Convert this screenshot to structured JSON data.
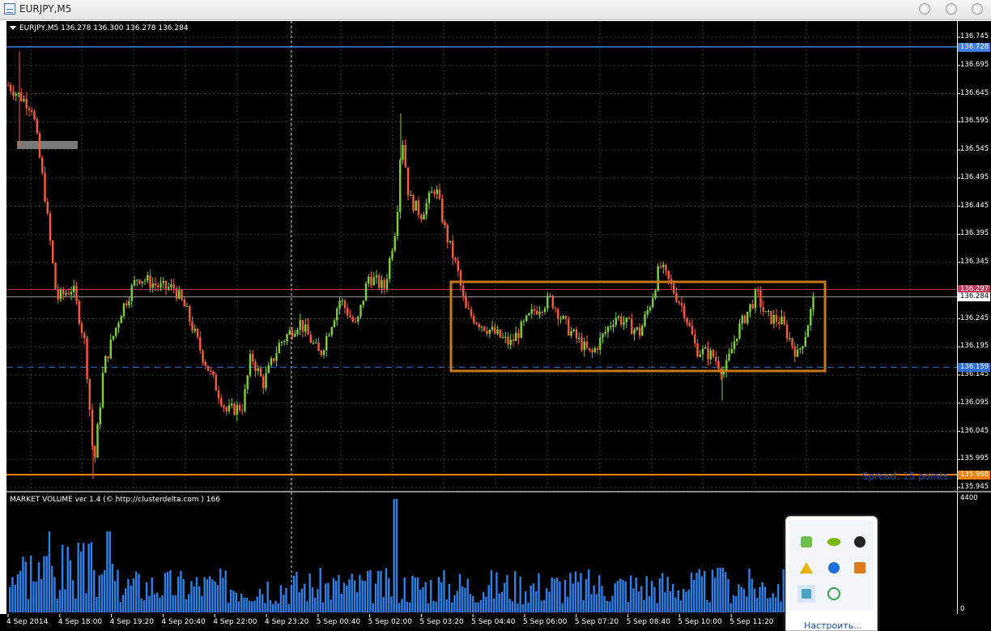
{
  "window": {
    "title": "EURJPY,M5"
  },
  "chart": {
    "info": "EURJPY,M5  136.278 136.300 136.278 136.284",
    "spread": "Spread: 15 points.",
    "price_ticks": [
      "136.745",
      "136.695",
      "136.645",
      "136.595",
      "136.545",
      "136.495",
      "136.445",
      "136.395",
      "136.345",
      "136.245",
      "136.195",
      "136.145",
      "136.095",
      "136.045",
      "135.995",
      "135.945"
    ],
    "level_tags": [
      {
        "price": "136.728",
        "color": "#3f7fe6"
      },
      {
        "price": "136.297",
        "color": "#c33b5c"
      },
      {
        "price": "136.284",
        "color": "#ffffff"
      },
      {
        "price": "136.159",
        "color": "#2f6fd9"
      },
      {
        "price": "135.968",
        "color": "#ff8000"
      }
    ],
    "colors": {
      "bull": "#7fd13a",
      "bear": "#ff5a3c",
      "range_box": "#c8791c",
      "volume": "#2f7fe8"
    }
  },
  "volume": {
    "label": "MARKET VOLUME ver 1.4 (© http://clusterdelta.com ) 166",
    "max": "4400",
    "min": "0"
  },
  "time_axis": {
    "labels": [
      "4 Sep 2014",
      "4 Sep 18:00",
      "4 Sep 19:20",
      "4 Sep 20:40",
      "4 Sep 22:00",
      "4 Sep 23:20",
      "5 Sep 00:40",
      "5 Sep 02:00",
      "5 Sep 03:20",
      "5 Sep 04:40",
      "5 Sep 06:00",
      "5 Sep 07:20",
      "5 Sep 08:40",
      "5 Sep 10:00",
      "5 Sep 11:20"
    ]
  },
  "tray": {
    "icons": [
      "evernote-icon",
      "nvidia-icon",
      "headset-icon",
      "warning-icon",
      "network-icon",
      "java-icon",
      "app-icon",
      "update-icon"
    ],
    "link": "Настроить..."
  }
}
